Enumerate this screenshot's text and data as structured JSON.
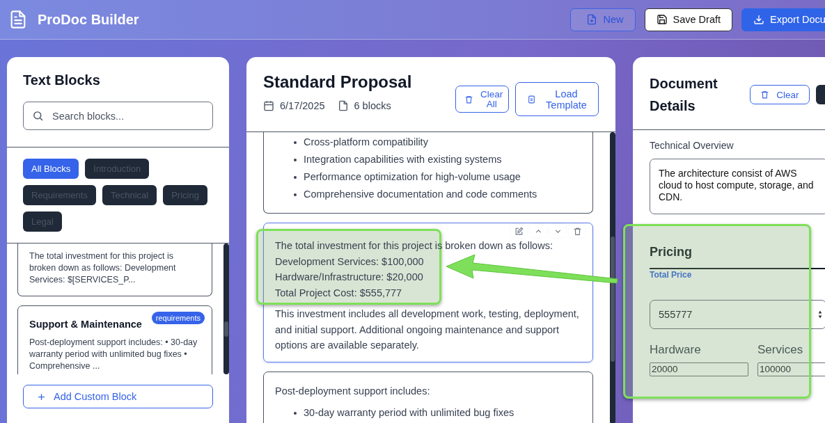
{
  "header": {
    "title": "ProDoc Builder",
    "buttons": [
      {
        "label": "New",
        "kind": "ghost"
      },
      {
        "label": "Save Draft",
        "kind": "outline"
      },
      {
        "label": "Export Docu",
        "kind": "primary"
      }
    ]
  },
  "library": {
    "title": "Text Blocks",
    "search": {
      "placeholder": "Search blocks..."
    },
    "filters": [
      {
        "label": "All Blocks",
        "selected": true
      },
      {
        "label": "Introduction",
        "selected": false
      },
      {
        "label": "Requirements",
        "selected": false
      },
      {
        "label": "Technical",
        "selected": false
      },
      {
        "label": "Pricing",
        "selected": false
      },
      {
        "label": "Legal",
        "selected": false
      }
    ],
    "blocks": [
      {
        "excerpt": "The total investment for this project is broken down as follows: Development Services: $[SERVICES_P..."
      },
      {
        "title": "Support & Maintenance",
        "badge": "requirements",
        "excerpt": "Post-deployment support includes: • 30-day warranty period with unlimited bug fixes • Comprehensive ..."
      }
    ],
    "add_button": "Add Custom Block"
  },
  "document": {
    "title": "Standard Proposal",
    "date": "6/17/2025",
    "block_count": "6 blocks",
    "buttons": [
      {
        "label": "Clear All",
        "kind": "clear"
      },
      {
        "label": "Load Template",
        "kind": "template"
      }
    ],
    "blocks": [
      {
        "kind": "list",
        "selected": false,
        "items": [
          "Cross-platform compatibility",
          "Integration capabilities with existing systems",
          "Performance optimization for high-volume usage",
          "Comprehensive documentation and code comments"
        ]
      },
      {
        "kind": "text",
        "selected": true,
        "lines": [
          "The total investment for this project is broken down as follows:",
          "Development Services: $100,000",
          "Hardware/Infrastructure: $20,000",
          "Total Project Cost: $555,777"
        ],
        "paragraph": "This investment includes all development work, testing, deployment, and initial support. Additional ongoing maintenance and support options are available separately."
      },
      {
        "kind": "list",
        "selected": false,
        "intro": "Post-deployment support includes:",
        "items": [
          "30-day warranty period with unlimited bug fixes"
        ]
      }
    ]
  },
  "details": {
    "title": "Document Details",
    "clear_button": "Clear",
    "overview": {
      "label": "Technical Overview",
      "value": "The architecture consist of AWS cloud to host compute, storage, and CDN."
    },
    "pricing": {
      "title": "Pricing",
      "total_label": "Total Price",
      "total_value": "555777",
      "hardware_label": "Hardware",
      "hardware_value": "20000",
      "services_label": "Services",
      "services_value": "100000"
    }
  }
}
